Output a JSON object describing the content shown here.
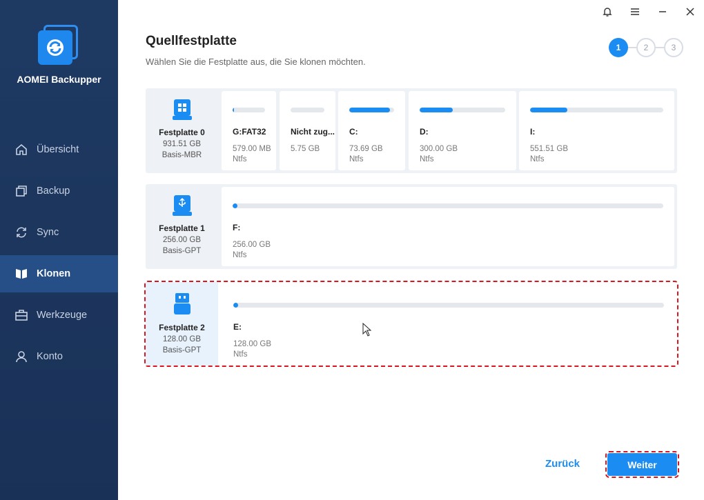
{
  "app": {
    "name": "AOMEI Backupper"
  },
  "window_controls": {
    "bell": "bell-icon",
    "menu": "menu-icon",
    "minimize": "minimize-icon",
    "close": "close-icon"
  },
  "sidebar": {
    "items": [
      {
        "label": "Übersicht",
        "icon": "home-icon",
        "active": false
      },
      {
        "label": "Backup",
        "icon": "backup-icon",
        "active": false
      },
      {
        "label": "Sync",
        "icon": "sync-icon",
        "active": false
      },
      {
        "label": "Klonen",
        "icon": "clone-icon",
        "active": true
      },
      {
        "label": "Werkzeuge",
        "icon": "toolbox-icon",
        "active": false
      },
      {
        "label": "Konto",
        "icon": "user-icon",
        "active": false
      }
    ]
  },
  "header": {
    "title": "Quellfestplatte",
    "subtitle": "Wählen Sie die Festplatte aus, die Sie klonen möchten."
  },
  "steps": [
    "1",
    "2",
    "3"
  ],
  "disks": [
    {
      "name": "Festplatte 0",
      "size": "931.51 GB",
      "type": "Basis-MBR",
      "icon": "windows-disk-icon",
      "partitions": [
        {
          "label": "G:FAT32",
          "size": "579.00 MB",
          "fs": "Ntfs",
          "used": 0.05
        },
        {
          "label": "Nicht zug...",
          "size": "5.75 GB",
          "fs": "",
          "used": 0.0
        },
        {
          "label": "C:",
          "size": "73.69 GB",
          "fs": "Ntfs",
          "used": 0.9
        },
        {
          "label": "D:",
          "size": "300.00 GB",
          "fs": "Ntfs",
          "used": 0.39
        },
        {
          "label": "I:",
          "size": "551.51 GB",
          "fs": "Ntfs",
          "used": 0.28
        }
      ]
    },
    {
      "name": "Festplatte 1",
      "size": "256.00 GB",
      "type": "Basis-GPT",
      "icon": "usb-disk-icon",
      "partitions": [
        {
          "label": "F:",
          "size": "256.00 GB",
          "fs": "Ntfs",
          "used": 0.005
        }
      ]
    },
    {
      "name": "Festplatte 2",
      "size": "128.00 GB",
      "type": "Basis-GPT",
      "icon": "usb-drive-icon",
      "selected": true,
      "partitions": [
        {
          "label": "E:",
          "size": "128.00 GB",
          "fs": "Ntfs",
          "used": 0.005
        }
      ]
    }
  ],
  "buttons": {
    "back": "Zurück",
    "next": "Weiter"
  },
  "colors": {
    "accent": "#1b8cf2",
    "sidebar": "#1e3a63",
    "highlight": "#d8161f"
  }
}
